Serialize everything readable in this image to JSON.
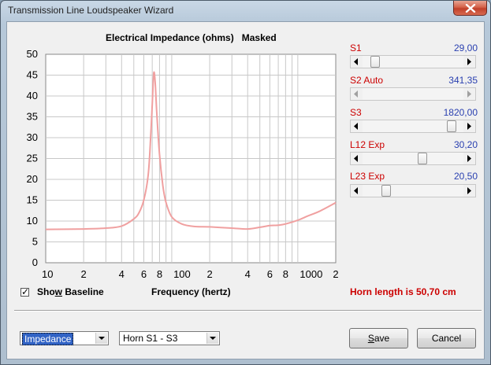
{
  "window": {
    "title": "Transmission Line Loudspeaker Wizard"
  },
  "chart": {
    "title": "Electrical Impedance (ohms)   Masked",
    "xlabel": "Frequency (hertz)"
  },
  "chart_data": {
    "type": "line",
    "title": "Electrical Impedance (ohms)   Masked",
    "xlabel": "Frequency (hertz)",
    "ylabel": "",
    "xscale": "log",
    "xlim": [
      10,
      2000
    ],
    "ylim": [
      0,
      50
    ],
    "yticks": [
      "0",
      "5",
      "10",
      "15",
      "20",
      "25",
      "30",
      "35",
      "40",
      "45",
      "50"
    ],
    "xticks": [
      "10",
      "2",
      "4",
      "6",
      "8",
      "100",
      "2",
      "4",
      "6",
      "8",
      "1000",
      "2"
    ],
    "grid": true,
    "series": [
      {
        "color": "#f0a0a0",
        "x": [
          10,
          20,
          30,
          40,
          50,
          55,
          60,
          65,
          68,
          70,
          72,
          74,
          76,
          80,
          85,
          90,
          100,
          120,
          150,
          200,
          300,
          400,
          500,
          600,
          700,
          800,
          1000,
          1200,
          1500,
          2000
        ],
        "y": [
          8.0,
          8.1,
          8.3,
          8.8,
          10.5,
          12.0,
          15.0,
          21.0,
          30.0,
          38.0,
          45.5,
          43.0,
          36.0,
          26.0,
          18.5,
          14.5,
          11.0,
          9.3,
          8.7,
          8.6,
          8.3,
          8.1,
          8.5,
          8.9,
          9.0,
          9.3,
          10.2,
          11.2,
          12.4,
          14.4
        ]
      }
    ]
  },
  "params": [
    {
      "label": "S1",
      "value": "29,00",
      "level": 0.09
    },
    {
      "label": "S2  Auto",
      "value": "341,35",
      "level": 0.0
    },
    {
      "label": "S3",
      "value": "1820,00",
      "level": 0.92
    },
    {
      "label": "L12  Exp",
      "value": "30,20",
      "level": 0.6
    },
    {
      "label": "L23  Exp",
      "value": "20,50",
      "level": 0.21
    }
  ],
  "baseline": {
    "checked": true,
    "checkmark": "✓",
    "label_pre": "Sho",
    "label_u": "w",
    "label_post": " Baseline"
  },
  "horn_length": "Horn length is 50,70 cm",
  "combos": {
    "view": "Impedance",
    "horn": "Horn S1 - S3"
  },
  "buttons": {
    "save_u": "S",
    "save_rest": "ave",
    "cancel": "Cancel"
  },
  "colors": {
    "accent_red": "#cc0000",
    "value_blue": "#2a40b0",
    "curve": "#f0a0a0",
    "selection": "#3163c5"
  }
}
